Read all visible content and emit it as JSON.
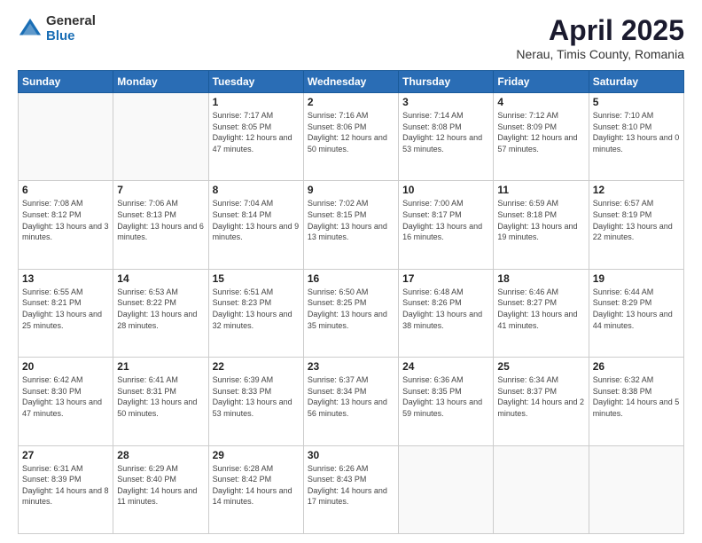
{
  "logo": {
    "general": "General",
    "blue": "Blue"
  },
  "title": "April 2025",
  "location": "Nerau, Timis County, Romania",
  "days_header": [
    "Sunday",
    "Monday",
    "Tuesday",
    "Wednesday",
    "Thursday",
    "Friday",
    "Saturday"
  ],
  "weeks": [
    [
      {
        "day": "",
        "info": ""
      },
      {
        "day": "",
        "info": ""
      },
      {
        "day": "1",
        "info": "Sunrise: 7:17 AM\nSunset: 8:05 PM\nDaylight: 12 hours and 47 minutes."
      },
      {
        "day": "2",
        "info": "Sunrise: 7:16 AM\nSunset: 8:06 PM\nDaylight: 12 hours and 50 minutes."
      },
      {
        "day": "3",
        "info": "Sunrise: 7:14 AM\nSunset: 8:08 PM\nDaylight: 12 hours and 53 minutes."
      },
      {
        "day": "4",
        "info": "Sunrise: 7:12 AM\nSunset: 8:09 PM\nDaylight: 12 hours and 57 minutes."
      },
      {
        "day": "5",
        "info": "Sunrise: 7:10 AM\nSunset: 8:10 PM\nDaylight: 13 hours and 0 minutes."
      }
    ],
    [
      {
        "day": "6",
        "info": "Sunrise: 7:08 AM\nSunset: 8:12 PM\nDaylight: 13 hours and 3 minutes."
      },
      {
        "day": "7",
        "info": "Sunrise: 7:06 AM\nSunset: 8:13 PM\nDaylight: 13 hours and 6 minutes."
      },
      {
        "day": "8",
        "info": "Sunrise: 7:04 AM\nSunset: 8:14 PM\nDaylight: 13 hours and 9 minutes."
      },
      {
        "day": "9",
        "info": "Sunrise: 7:02 AM\nSunset: 8:15 PM\nDaylight: 13 hours and 13 minutes."
      },
      {
        "day": "10",
        "info": "Sunrise: 7:00 AM\nSunset: 8:17 PM\nDaylight: 13 hours and 16 minutes."
      },
      {
        "day": "11",
        "info": "Sunrise: 6:59 AM\nSunset: 8:18 PM\nDaylight: 13 hours and 19 minutes."
      },
      {
        "day": "12",
        "info": "Sunrise: 6:57 AM\nSunset: 8:19 PM\nDaylight: 13 hours and 22 minutes."
      }
    ],
    [
      {
        "day": "13",
        "info": "Sunrise: 6:55 AM\nSunset: 8:21 PM\nDaylight: 13 hours and 25 minutes."
      },
      {
        "day": "14",
        "info": "Sunrise: 6:53 AM\nSunset: 8:22 PM\nDaylight: 13 hours and 28 minutes."
      },
      {
        "day": "15",
        "info": "Sunrise: 6:51 AM\nSunset: 8:23 PM\nDaylight: 13 hours and 32 minutes."
      },
      {
        "day": "16",
        "info": "Sunrise: 6:50 AM\nSunset: 8:25 PM\nDaylight: 13 hours and 35 minutes."
      },
      {
        "day": "17",
        "info": "Sunrise: 6:48 AM\nSunset: 8:26 PM\nDaylight: 13 hours and 38 minutes."
      },
      {
        "day": "18",
        "info": "Sunrise: 6:46 AM\nSunset: 8:27 PM\nDaylight: 13 hours and 41 minutes."
      },
      {
        "day": "19",
        "info": "Sunrise: 6:44 AM\nSunset: 8:29 PM\nDaylight: 13 hours and 44 minutes."
      }
    ],
    [
      {
        "day": "20",
        "info": "Sunrise: 6:42 AM\nSunset: 8:30 PM\nDaylight: 13 hours and 47 minutes."
      },
      {
        "day": "21",
        "info": "Sunrise: 6:41 AM\nSunset: 8:31 PM\nDaylight: 13 hours and 50 minutes."
      },
      {
        "day": "22",
        "info": "Sunrise: 6:39 AM\nSunset: 8:33 PM\nDaylight: 13 hours and 53 minutes."
      },
      {
        "day": "23",
        "info": "Sunrise: 6:37 AM\nSunset: 8:34 PM\nDaylight: 13 hours and 56 minutes."
      },
      {
        "day": "24",
        "info": "Sunrise: 6:36 AM\nSunset: 8:35 PM\nDaylight: 13 hours and 59 minutes."
      },
      {
        "day": "25",
        "info": "Sunrise: 6:34 AM\nSunset: 8:37 PM\nDaylight: 14 hours and 2 minutes."
      },
      {
        "day": "26",
        "info": "Sunrise: 6:32 AM\nSunset: 8:38 PM\nDaylight: 14 hours and 5 minutes."
      }
    ],
    [
      {
        "day": "27",
        "info": "Sunrise: 6:31 AM\nSunset: 8:39 PM\nDaylight: 14 hours and 8 minutes."
      },
      {
        "day": "28",
        "info": "Sunrise: 6:29 AM\nSunset: 8:40 PM\nDaylight: 14 hours and 11 minutes."
      },
      {
        "day": "29",
        "info": "Sunrise: 6:28 AM\nSunset: 8:42 PM\nDaylight: 14 hours and 14 minutes."
      },
      {
        "day": "30",
        "info": "Sunrise: 6:26 AM\nSunset: 8:43 PM\nDaylight: 14 hours and 17 minutes."
      },
      {
        "day": "",
        "info": ""
      },
      {
        "day": "",
        "info": ""
      },
      {
        "day": "",
        "info": ""
      }
    ]
  ]
}
